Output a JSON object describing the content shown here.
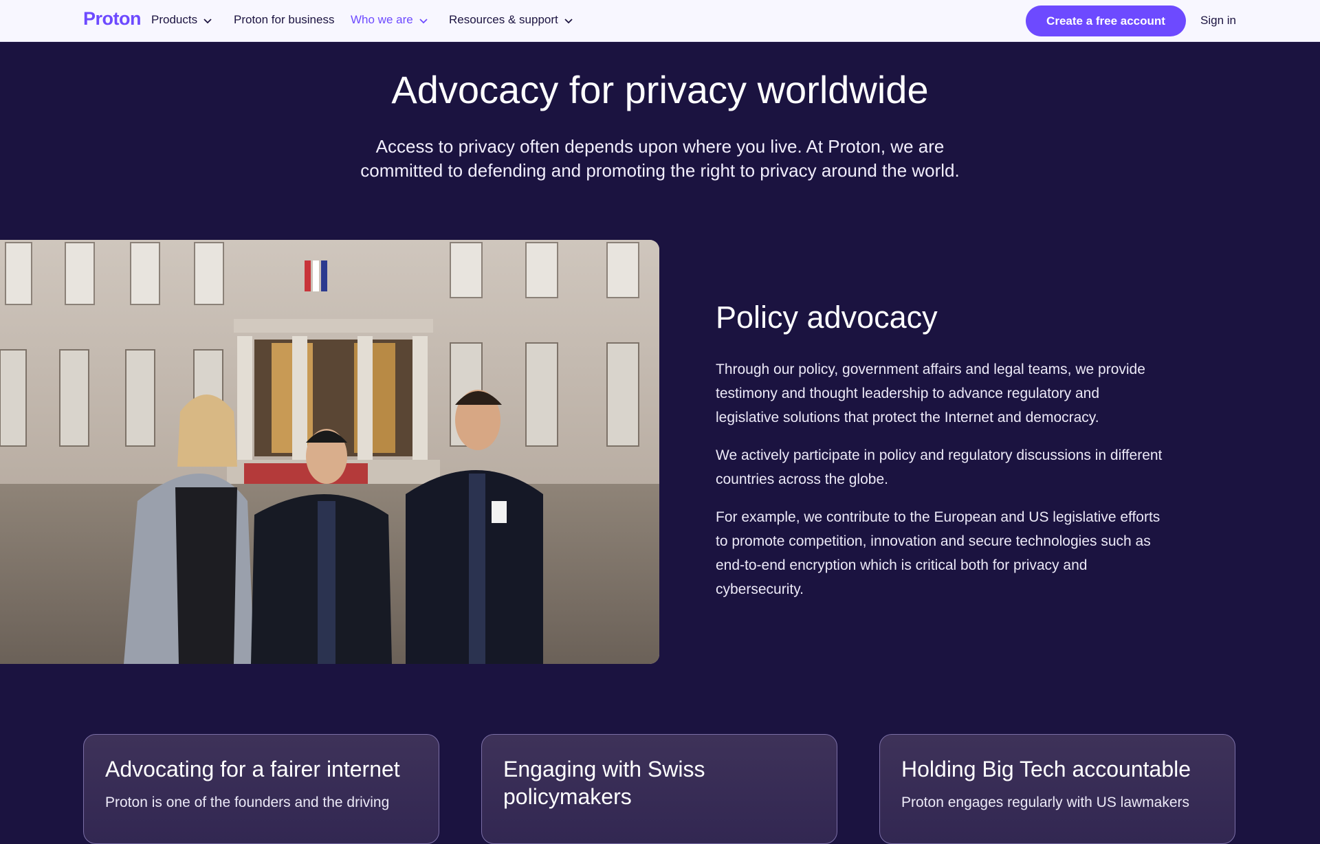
{
  "nav": {
    "logo": "Proton",
    "items": [
      {
        "label": "Products",
        "dropdown": true
      },
      {
        "label": "Proton for business",
        "dropdown": false
      },
      {
        "label": "Who we are",
        "dropdown": true,
        "active": true
      },
      {
        "label": "Resources & support",
        "dropdown": true
      }
    ],
    "cta_label": "Create a free account",
    "signin_label": "Sign in"
  },
  "hero": {
    "title": "Advocacy for privacy worldwide",
    "subtitle": "Access to privacy often depends upon where you live. At Proton, we are committed to defending and promoting the right to privacy around the world."
  },
  "policy": {
    "title": "Policy advocacy",
    "paragraphs": [
      "Through our policy, government affairs and legal teams, we provide testimony and thought leadership to advance regulatory and legislative solutions that protect the Internet and democracy.",
      "We actively participate in policy and regulatory discussions in different countries across the globe.",
      "For example, we contribute to the European and US legislative efforts to promote competition, innovation and secure technologies such as end-to-end encryption which is critical both for privacy and cybersecurity."
    ]
  },
  "cards": [
    {
      "title": "Advocating for a fairer internet",
      "text": "Proton is one of the founders and the driving"
    },
    {
      "title": "Engaging with Swiss policymakers",
      "text": ""
    },
    {
      "title": "Holding Big Tech accountable",
      "text": "Proton engages regularly with US lawmakers"
    }
  ],
  "colors": {
    "brand": "#6d4aff",
    "background": "#1b1340",
    "nav_background": "#f8f7ff"
  },
  "icons": {
    "chevron": "chevron-down-icon"
  }
}
